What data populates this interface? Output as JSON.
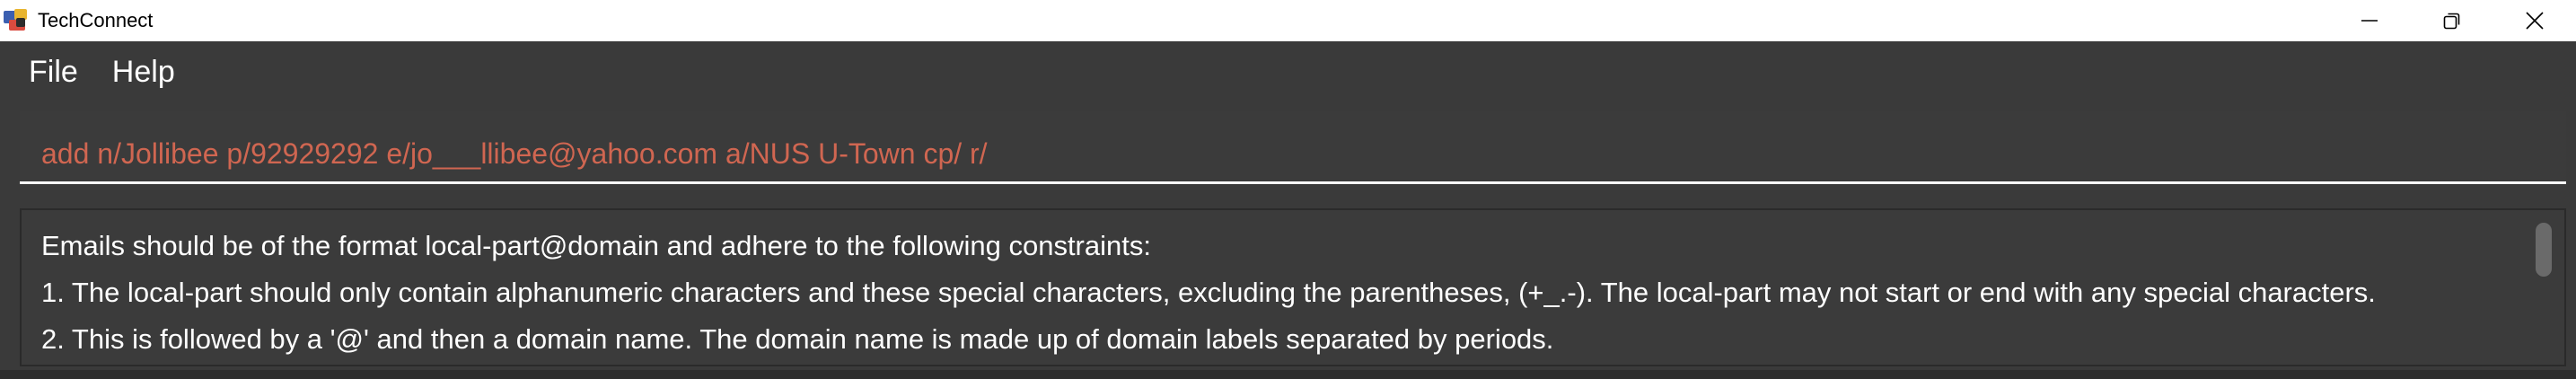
{
  "window": {
    "title": "TechConnect",
    "icons": {
      "app_logo": "techconnect-logo-icon",
      "minimize": "minimize-icon",
      "maximize": "restore-icon",
      "close": "close-icon"
    }
  },
  "menu": {
    "items": [
      {
        "label": "File"
      },
      {
        "label": "Help"
      }
    ]
  },
  "command": {
    "value": "add n/Jollibee p/92929292 e/jo___llibee@yahoo.com a/NUS U-Town cp/ r/",
    "text_color": "#d06651"
  },
  "result": {
    "lines": [
      "Emails should be of the format local-part@domain and adhere to the following constraints:",
      "1. The local-part should only contain alphanumeric characters and these special characters, excluding the parentheses, (+_.-). The local-part may not start or end with any special characters.",
      "2. This is followed by a '@' and then a domain name. The domain name is made up of domain labels separated by periods."
    ]
  },
  "colors": {
    "background": "#3a3a3a",
    "titlebar": "#ffffff",
    "error_text": "#d06651"
  }
}
